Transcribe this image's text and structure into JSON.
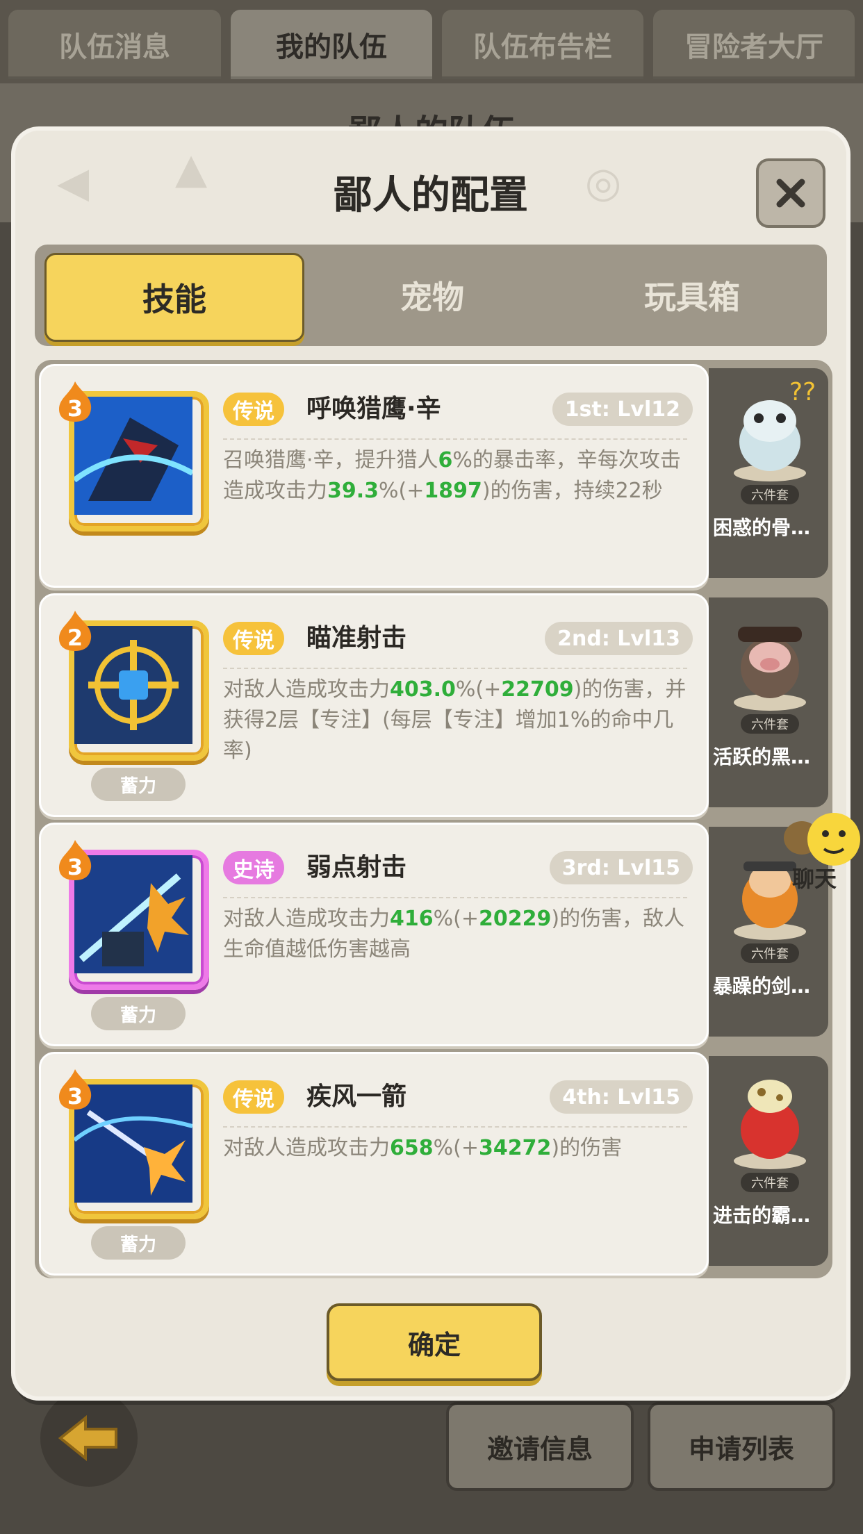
{
  "top_tabs": [
    {
      "label": "队伍消息",
      "active": false
    },
    {
      "label": "我的队伍",
      "active": true
    },
    {
      "label": "队伍布告栏",
      "active": false
    },
    {
      "label": "冒险者大厅",
      "active": false
    }
  ],
  "background_title": "鄙人的队伍",
  "modal": {
    "title": "鄙人的配置",
    "close_icon": "close-icon",
    "segments": [
      {
        "label": "技能",
        "active": true
      },
      {
        "label": "宠物",
        "active": false
      },
      {
        "label": "玩具箱",
        "active": false
      }
    ],
    "skills": [
      {
        "level_badge": "3",
        "rarity": "传说",
        "name": "呼唤猎鹰·辛",
        "slot_level": "1st: Lvl12",
        "desc_parts": [
          "召唤猎鹰·辛，提升猎人",
          "6",
          "%的暴击率，辛每次攻击造成攻击力",
          "39.3",
          "%(+",
          "1897",
          ")的伤害，持续22秒"
        ],
        "charge": "",
        "icon": "falcon-skill-icon",
        "pet_name": "困惑的骨…",
        "pet_badge": "六件套"
      },
      {
        "level_badge": "2",
        "rarity": "传说",
        "name": "瞄准射击",
        "slot_level": "2nd: Lvl13",
        "desc_parts": [
          "对敌人造成攻击力",
          "403.0",
          "%(+",
          "22709",
          ")的伤害，并获得2层【专注】(每层【专注】增加1%的命中几率)"
        ],
        "charge": "蓄力",
        "icon": "aim-shot-icon",
        "pet_name": "活跃的黑…",
        "pet_badge": "六件套"
      },
      {
        "level_badge": "3",
        "rarity": "史诗",
        "name": "弱点射击",
        "slot_level": "3rd: Lvl15",
        "desc_parts": [
          "对敌人造成攻击力",
          "416",
          "%(+",
          "20229",
          ")的伤害，敌人生命值越低伤害越高"
        ],
        "charge": "蓄力",
        "icon": "weakpoint-shot-icon",
        "pet_name": "暴躁的剑…",
        "pet_badge": "六件套"
      },
      {
        "level_badge": "3",
        "rarity": "传说",
        "name": "疾风一箭",
        "slot_level": "4th: Lvl15",
        "desc_parts": [
          "对敌人造成攻击力",
          "658",
          "%(+",
          "34272",
          ")的伤害"
        ],
        "charge": "蓄力",
        "icon": "gale-arrow-icon",
        "pet_name": "进击的霸…",
        "pet_badge": "六件套"
      }
    ],
    "confirm_label": "确定"
  },
  "chat": {
    "label": "聊天"
  },
  "bottom_buttons": {
    "invite": "邀请信息",
    "requests": "申请列表"
  },
  "colors": {
    "accent_yellow": "#f6d45c",
    "legend_orange": "#f6c23b",
    "epic_pink": "#e67ae0",
    "green": "#2fae3a"
  }
}
